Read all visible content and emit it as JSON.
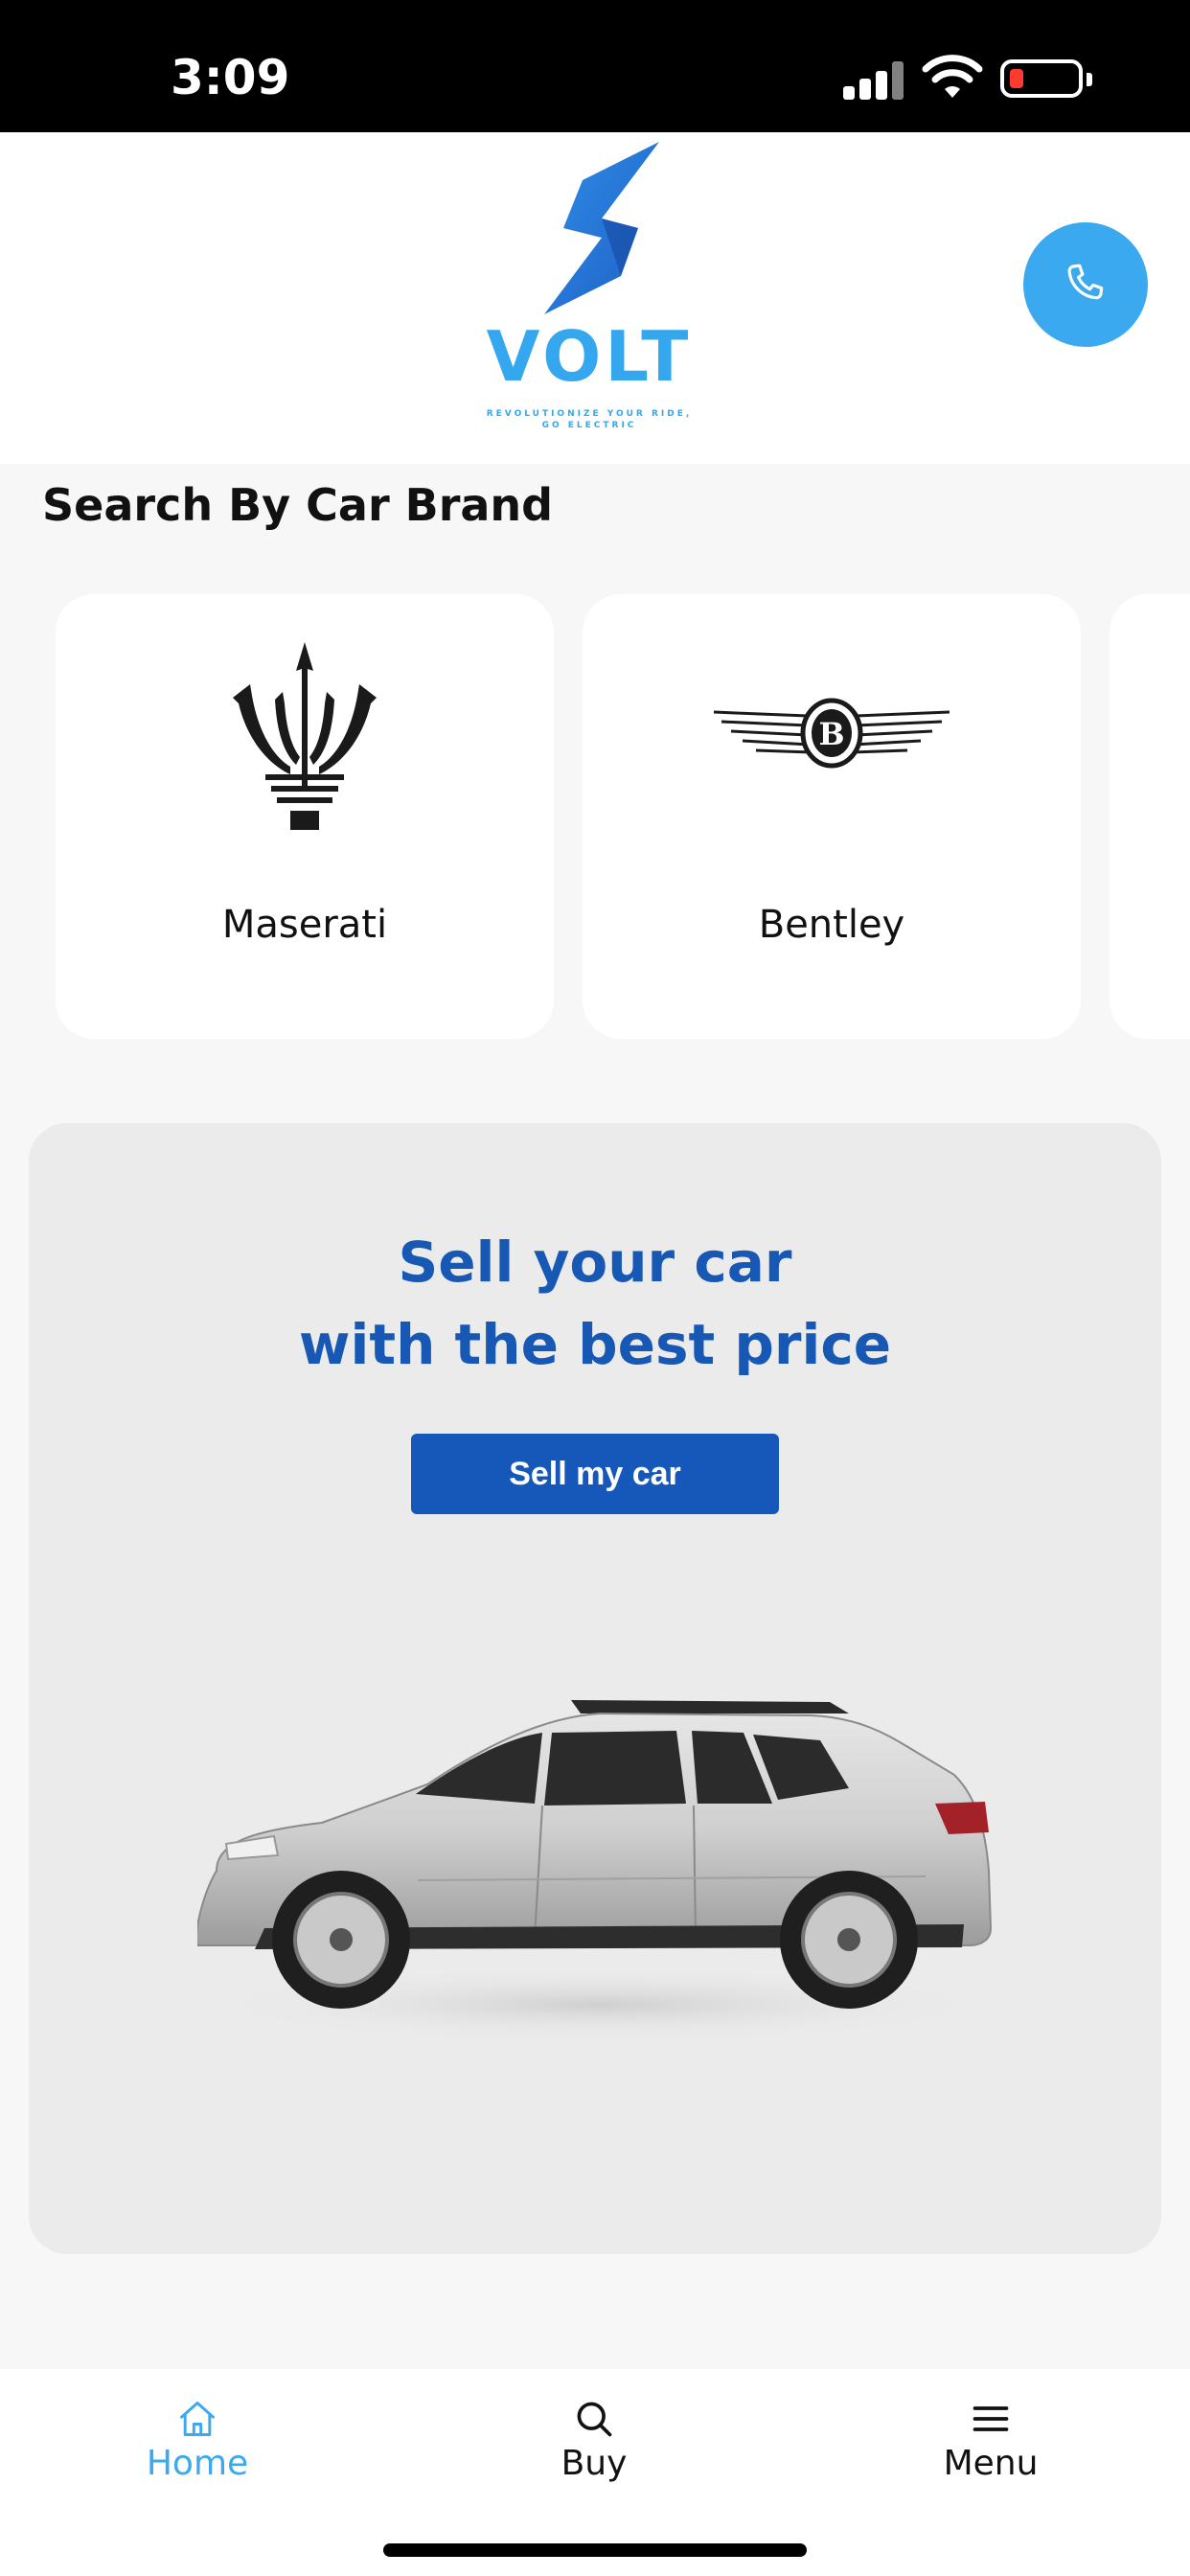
{
  "status_bar": {
    "time": "3:09"
  },
  "header": {
    "logo": {
      "name": "VOLT",
      "tagline_line1": "REVOLUTIONIZE YOUR RIDE,",
      "tagline_line2": "GO ELECTRIC"
    },
    "call_icon": "phone-icon"
  },
  "brands": {
    "title": "Search By Car Brand",
    "items": [
      {
        "label": "Maserati",
        "icon": "maserati-logo"
      },
      {
        "label": "Bentley",
        "icon": "bentley-logo"
      }
    ]
  },
  "sell": {
    "title_line1": "Sell your car",
    "title_line2": "with the best price",
    "button_label": "Sell my car"
  },
  "nav": {
    "items": [
      {
        "label": "Home",
        "icon": "home-icon",
        "active": true
      },
      {
        "label": "Buy",
        "icon": "search-icon",
        "active": false
      },
      {
        "label": "Menu",
        "icon": "menu-icon",
        "active": false
      }
    ]
  },
  "colors": {
    "accent": "#3aa9f0",
    "primary_blue": "#1658b9",
    "active_nav": "#3aa9f0"
  }
}
